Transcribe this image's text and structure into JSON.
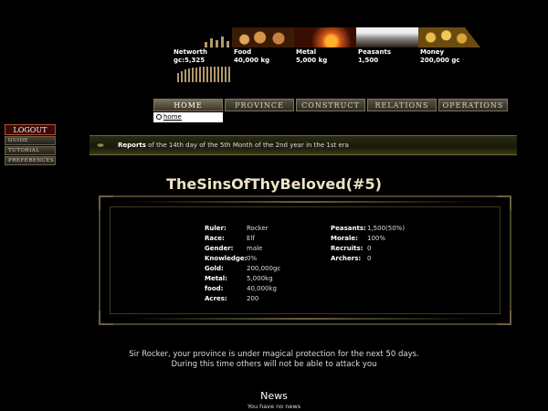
{
  "resources": [
    {
      "label": "Networth",
      "value": "gc:5,325"
    },
    {
      "label": "Food",
      "value": "40,000 kg"
    },
    {
      "label": "Metal",
      "value": "5,000 kg"
    },
    {
      "label": "Peasants",
      "value": "1,500"
    },
    {
      "label": "Money",
      "value": "200,000 gc"
    }
  ],
  "nav": {
    "tabs": [
      "HOME",
      "PROVINCE",
      "CONSTRUCT",
      "RELATIONS",
      "OPERATIONS"
    ],
    "active": "HOME",
    "sub_item": "home"
  },
  "left_menu": {
    "logout": "LOGOUT",
    "items": [
      "GUIDE",
      "TUTORIAL",
      "PREFERENCES"
    ]
  },
  "report": {
    "label": "Reports",
    "text": "of the 14th day of the 5th Month of the 2nd year in the 1st era"
  },
  "province": {
    "title": "TheSinsOfThyBeloved(#5)",
    "left_stats": [
      {
        "key": "Ruler:",
        "value": "Rocker"
      },
      {
        "key": "Race:",
        "value": "Elf"
      },
      {
        "key": "Gender:",
        "value": "male"
      },
      {
        "key": "Knowledge:",
        "value": "0%"
      },
      {
        "key": "Gold:",
        "value": "200,000gc"
      },
      {
        "key": "Metal:",
        "value": "5,000kg"
      },
      {
        "key": "food:",
        "value": "40,000kg"
      },
      {
        "key": "Acres:",
        "value": "200"
      }
    ],
    "right_stats": [
      {
        "key": "Peasants:",
        "value": "1,500(50%)"
      },
      {
        "key": "Morale:",
        "value": "100%"
      },
      {
        "key": "Recruits:",
        "value": "0"
      },
      {
        "key": "Archers:",
        "value": "0"
      }
    ]
  },
  "protection": {
    "line1": "Sir Rocker, your province is under magical protection for the next 50 days.",
    "line2": "During this time others will not be able to attack you"
  },
  "news": {
    "title": "News",
    "empty": "You have no news"
  },
  "colors": {
    "background": "#000000",
    "title": "#ece4c4",
    "logout_bg": "#3a0a08"
  }
}
